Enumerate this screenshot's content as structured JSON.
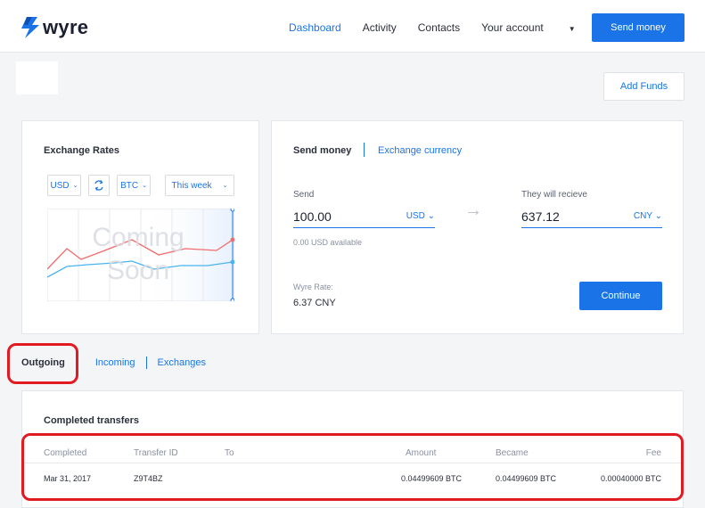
{
  "brand": {
    "name": "wyre",
    "color": "#1a74e8"
  },
  "nav": {
    "items": [
      "Dashboard",
      "Activity",
      "Contacts",
      "Your account"
    ],
    "active": "Dashboard",
    "send_button": "Send money"
  },
  "add_funds": "Add Funds",
  "rates": {
    "title": "Exchange Rates",
    "from_currency": "USD",
    "to_currency": "BTC",
    "period": "This week",
    "overlay_line1": "Coming",
    "overlay_line2": "Soon",
    "swap_icon": "swap-icon"
  },
  "send": {
    "tabs": [
      "Send money",
      "Exchange currency"
    ],
    "send_label": "Send",
    "send_amount": "100.00",
    "send_currency": "USD",
    "available": "0.00 USD available",
    "receive_label": "They will recieve",
    "receive_amount": "637.12",
    "receive_currency": "CNY",
    "rate_label": "Wyre Rate:",
    "rate_value": "6.37 CNY",
    "continue": "Continue"
  },
  "transfers": {
    "tabs": [
      "Outgoing",
      "Incoming",
      "Exchanges"
    ],
    "active_tab": "Outgoing",
    "title": "Completed transfers",
    "columns": [
      "Completed",
      "Transfer ID",
      "To",
      "Amount",
      "Became",
      "Fee"
    ],
    "rows": [
      {
        "completed": "Mar 31, 2017",
        "transfer_id": "Z9T4BZ",
        "to": "",
        "amount": "0.04499609 BTC",
        "became": "0.04499609 BTC",
        "fee": "0.00040000 BTC"
      }
    ]
  },
  "colors": {
    "accent": "#1a74e8",
    "highlight": "#e21b23",
    "line_red": "#f26d6d",
    "line_blue": "#4ab3f0"
  }
}
